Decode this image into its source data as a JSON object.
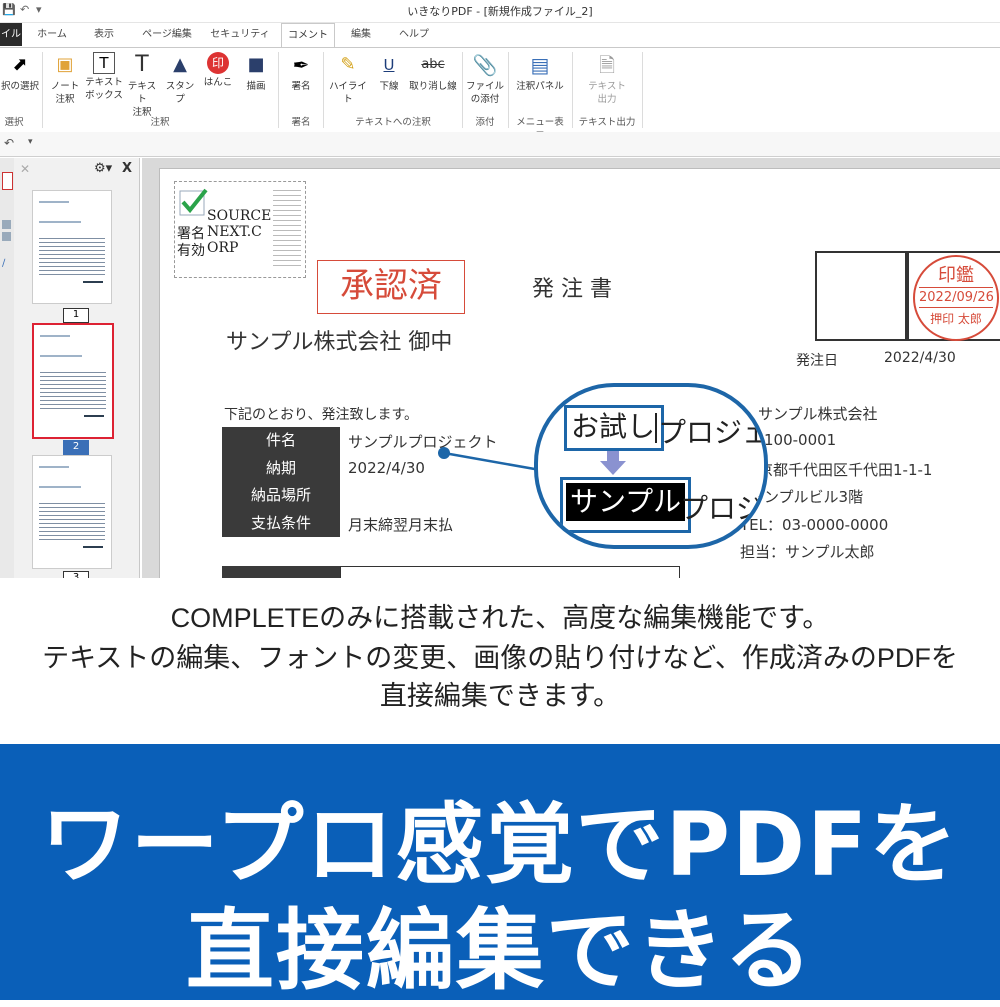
{
  "window": {
    "title": "いきなりPDF - [新規作成ファイル_2]"
  },
  "tabs": [
    "イル",
    "ホーム",
    "表示",
    "ページ編集",
    "セキュリティ",
    "コメント",
    "編集",
    "ヘルプ"
  ],
  "ribbon": {
    "select_label": "択の選択",
    "note_label": "ノート\n注釈",
    "textbox_label": "テキスト\nボックス",
    "text_note_label": "テキスト\n注釈",
    "stamp_label": "スタンプ",
    "hanko_label": "はんこ",
    "draw_label": "描画",
    "sign_label": "署名",
    "highlight_label": "ハイライト",
    "underline_label": "下線",
    "strike_label": "取り消し線",
    "attach_label": "ファイル\nの添付",
    "panel_label": "注釈パネル",
    "textout_label": "テキスト\n出力",
    "groups": {
      "select": "選択",
      "annot": "注釈",
      "sign": "署名",
      "text_annot": "テキストへの注釈",
      "attach": "添付",
      "menu": "メニュー表示",
      "textout": "テキスト出力"
    }
  },
  "thumbnails": {
    "pages": [
      "1",
      "2",
      "3"
    ],
    "selected": "2"
  },
  "document": {
    "sign_text": "SOURCE\nNEXT.C\nORP",
    "sign_jp": "署名\n有効",
    "approved_stamp": "承認済",
    "title": "発 注 書",
    "addressee": "サンプル株式会社 御中",
    "order_date_label": "発注日",
    "order_date": "2022/4/30",
    "hanko_top": "印鑑",
    "hanko_date": "2022/09/26",
    "hanko_name": "押印 太郎",
    "intro": "下記のとおり、発注致します。",
    "rows": [
      {
        "label": "件名",
        "value": "サンプルプロジェクト"
      },
      {
        "label": "納期",
        "value": "2022/4/30"
      },
      {
        "label": "納品場所",
        "value": ""
      },
      {
        "label": "支払条件",
        "value": "月末締翌月末払"
      }
    ],
    "company_lines": [
      "サンプル株式会社",
      "100-0001",
      "京都千代田区千代田1-1-1",
      "ンプルビル3階",
      "TEL：03-0000-0000",
      "担当：サンプル太郎"
    ],
    "zoom_before_a": "お試し",
    "zoom_before_b": "プロジェ",
    "zoom_after_a": "サンプル",
    "zoom_after_b": "プロジ"
  },
  "caption": {
    "line1": "COMPLETEのみに搭載された、高度な編集機能です。",
    "line2": "テキストの編集、フォントの変更、画像の貼り付けなど、作成済みのPDFを",
    "line3": "直接編集できます。"
  },
  "banner": {
    "line1": "ワープロ感覚でPDFを",
    "line2": "直接編集できる"
  },
  "colors": {
    "banner": "#0a5fb8",
    "stamp_red": "#d64b3a",
    "zoom_blue": "#1d66a8",
    "selected_page": "#3a6fb7"
  }
}
